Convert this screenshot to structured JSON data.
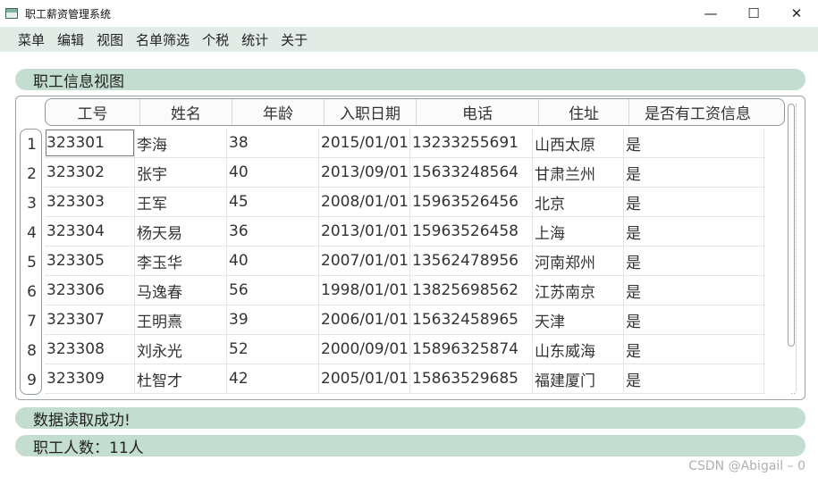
{
  "window": {
    "title": "职工薪资管理系统",
    "controls": {
      "minimize": "—",
      "maximize": "☐",
      "close": "✕"
    }
  },
  "menubar": {
    "items": [
      "菜单",
      "编辑",
      "视图",
      "名单筛选",
      "个税",
      "统计",
      "关于"
    ]
  },
  "sections": {
    "view_title": "职工信息视图",
    "status_text": "数据读取成功!",
    "count_text": "职工人数：11人"
  },
  "table": {
    "columns": [
      "工号",
      "姓名",
      "年龄",
      "入职日期",
      "电话",
      "住址",
      "是否有工资信息"
    ],
    "row_numbers": [
      "1",
      "2",
      "3",
      "4",
      "5",
      "6",
      "7",
      "8",
      "9"
    ],
    "rows": [
      [
        "323301",
        "李海",
        "38",
        "2015/01/01",
        "13233255691",
        "山西太原",
        "是"
      ],
      [
        "323302",
        "张宇",
        "40",
        "2013/09/01",
        "15633248564",
        "甘肃兰州",
        "是"
      ],
      [
        "323303",
        "王军",
        "45",
        "2008/01/01",
        "15963526456",
        "北京",
        "是"
      ],
      [
        "323304",
        "杨天易",
        "36",
        "2013/01/01",
        "15963526458",
        "上海",
        "是"
      ],
      [
        "323305",
        "李玉华",
        "40",
        "2007/01/01",
        "13562478956",
        "河南郑州",
        "是"
      ],
      [
        "323306",
        "马逸春",
        "56",
        "1998/01/01",
        "13825698562",
        "江苏南京",
        "是"
      ],
      [
        "323307",
        "王明熹",
        "39",
        "2006/01/01",
        "15632458965",
        "天津",
        "是"
      ],
      [
        "323308",
        "刘永光",
        "52",
        "2000/09/01",
        "15896325874",
        "山东威海",
        "是"
      ],
      [
        "323309",
        "杜智才",
        "42",
        "2005/01/01",
        "15863529685",
        "福建厦门",
        "是"
      ]
    ]
  },
  "watermark": "CSDN @Abigail – 0",
  "colors": {
    "menubar_bg": "#e3ebe7",
    "pill_bg": "#c3ddd1"
  }
}
